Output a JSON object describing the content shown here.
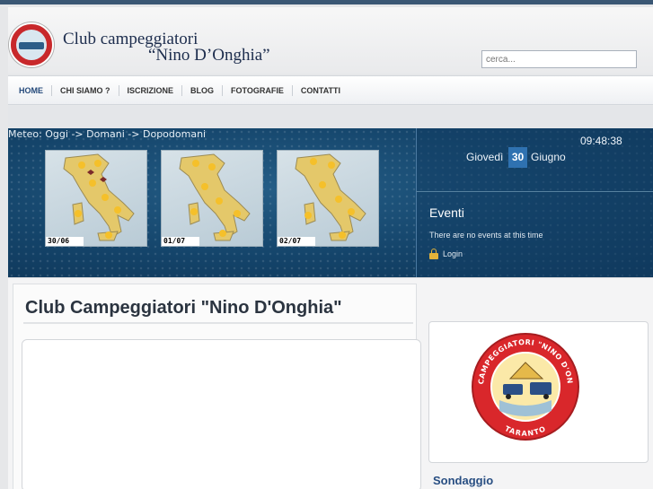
{
  "header": {
    "logo_line1": "Club campeggiatori",
    "logo_line2": "“Nino D’Onghia”",
    "search_placeholder": "cerca..."
  },
  "nav": {
    "items": [
      "HOME",
      "CHI SIAMO ?",
      "ISCRIZIONE",
      "BLOG",
      "FOTOGRAFIE",
      "CONTATTI"
    ]
  },
  "banner": {
    "meteo_label": "Meteo: Oggi -> Domani -> Dopodomani",
    "maps": [
      {
        "date": "30/06"
      },
      {
        "date": "01/07"
      },
      {
        "date": "02/07"
      }
    ]
  },
  "sidebar_widget": {
    "time": "09:48:38",
    "day_name": "Giovedì",
    "day_number": "30",
    "month": "Giugno",
    "events_title": "Eventi",
    "events_empty": "There are no events at this time",
    "login_label": "Login",
    "icons": {
      "login": "lock-icon"
    }
  },
  "main": {
    "page_title": "Club Campeggiatori \"Nino D'Onghia\""
  },
  "right_column": {
    "logo_text_top": "CLUB CAMPEGGIATORI \"NINO D'ONGHIA\"",
    "logo_text_bottom": "TARANTO",
    "poll_title": "Sondaggio"
  },
  "colors": {
    "banner_blue": "#14446a",
    "date_highlight": "#2f72b1",
    "title_text": "#2b3440",
    "poll_title": "#284e82"
  }
}
